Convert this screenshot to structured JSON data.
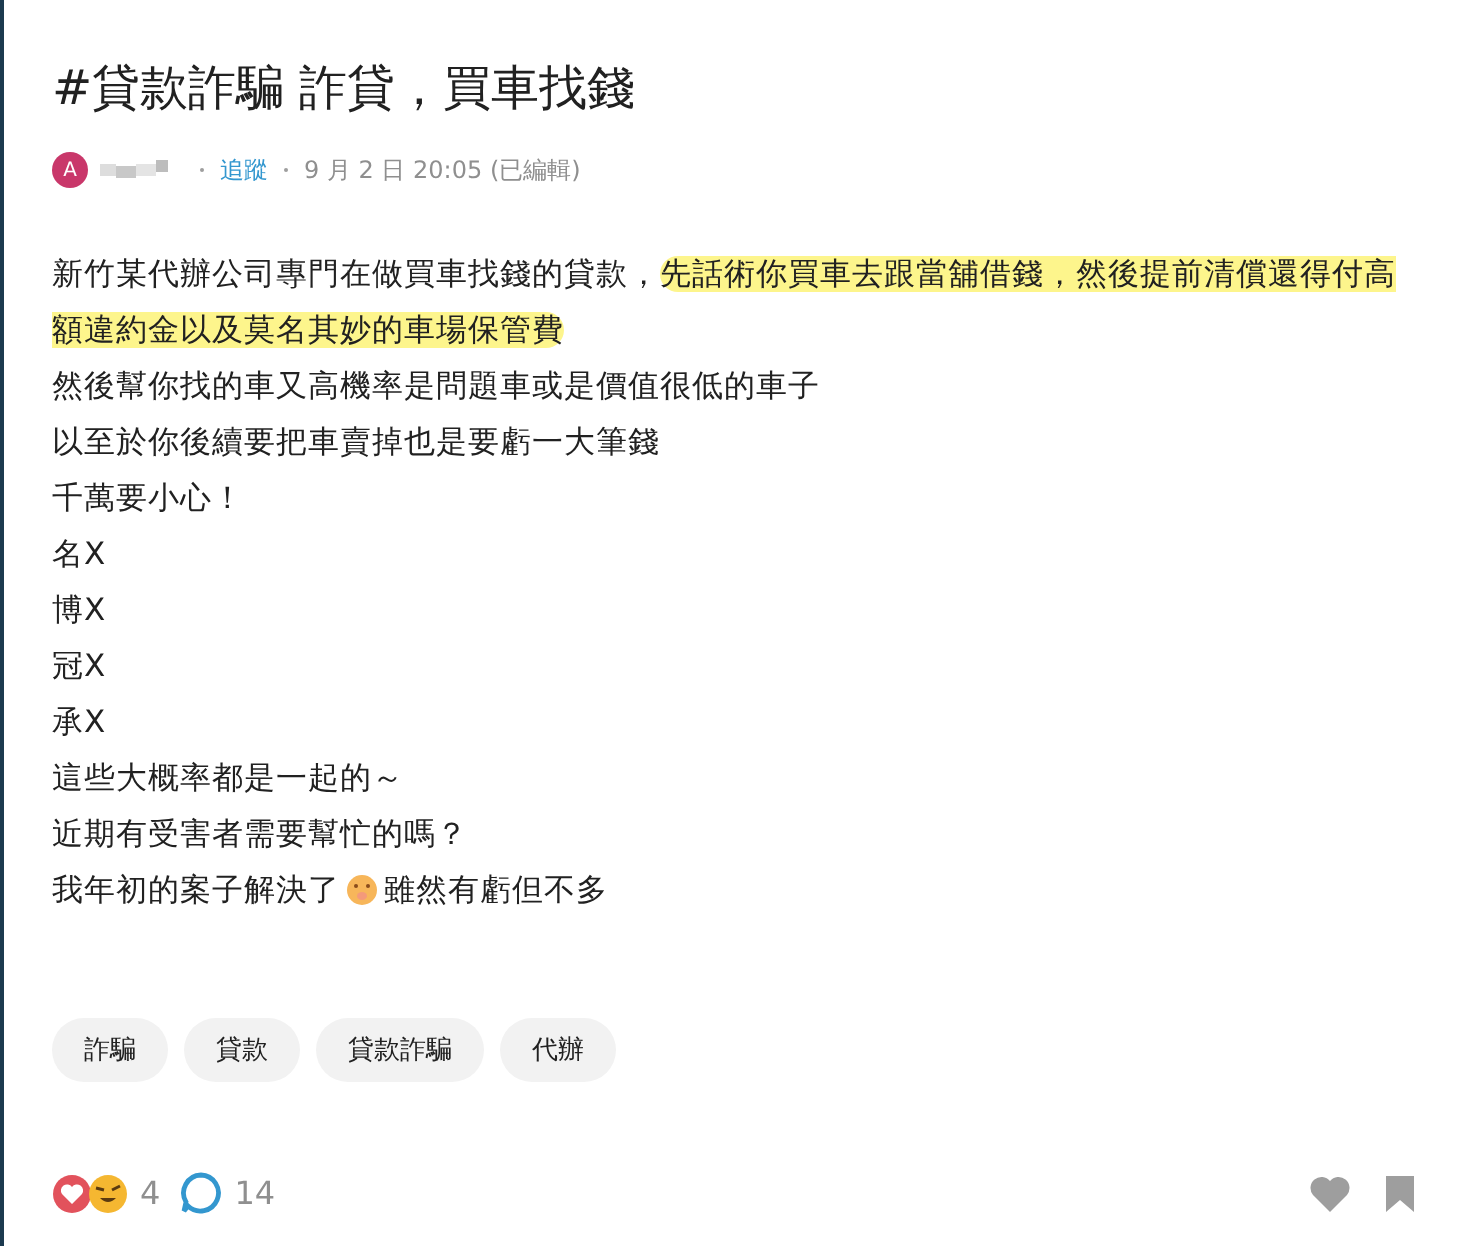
{
  "post": {
    "title": "#貸款詐騙 詐貸，買車找錢",
    "author": {
      "avatar_letter": "A",
      "follow": "追蹤",
      "date": "9 月 2 日 20:05",
      "edited": "(已編輯)"
    },
    "body": [
      {
        "kind": "text",
        "segments": [
          {
            "text": "新竹某代辦公司專門在做買車找錢的貸款，",
            "highlighted": false
          },
          {
            "text": "先話術你買車去跟當舖借錢，然後提前清償還得付高額違約金以及莫名其妙的車場保管費",
            "highlighted": true
          }
        ]
      },
      {
        "kind": "text",
        "segments": [
          {
            "text": "然後幫你找的車又高機率是問題車或是價值很低的車子",
            "highlighted": false
          }
        ]
      },
      {
        "kind": "text",
        "segments": [
          {
            "text": "以至於你後續要把車賣掉也是要虧一大筆錢",
            "highlighted": false
          }
        ]
      },
      {
        "kind": "text",
        "segments": [
          {
            "text": "千萬要小心！",
            "highlighted": false
          }
        ]
      },
      {
        "kind": "text",
        "segments": [
          {
            "text": "名X",
            "highlighted": false
          }
        ]
      },
      {
        "kind": "text",
        "segments": [
          {
            "text": "博X",
            "highlighted": false
          }
        ]
      },
      {
        "kind": "text",
        "segments": [
          {
            "text": "冠X",
            "highlighted": false
          }
        ]
      },
      {
        "kind": "text",
        "segments": [
          {
            "text": "承X",
            "highlighted": false
          }
        ]
      },
      {
        "kind": "text",
        "segments": [
          {
            "text": "這些大概率都是一起的～",
            "highlighted": false
          }
        ]
      },
      {
        "kind": "text",
        "segments": [
          {
            "text": "近期有受害者需要幫忙的嗎？",
            "highlighted": false
          }
        ]
      },
      {
        "kind": "emoji",
        "before": "我年初的案子解決了",
        "after": "雖然有虧但不多"
      }
    ],
    "tags": [
      "詐騙",
      "貸款",
      "貸款詐騙",
      "代辦"
    ],
    "reactions": {
      "count": "4",
      "comments": "14"
    }
  }
}
